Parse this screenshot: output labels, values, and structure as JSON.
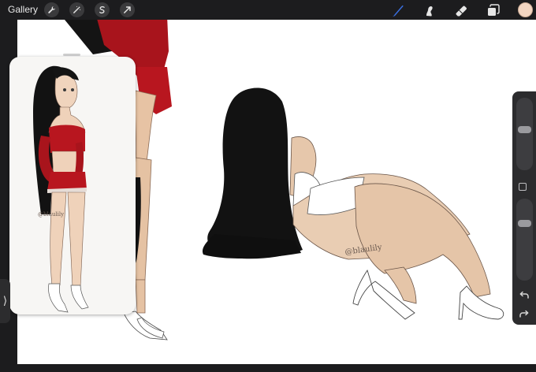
{
  "toolbar": {
    "gallery_label": "Gallery",
    "left_tools": [
      "wrench-icon",
      "magic-wand-icon",
      "selection-icon",
      "transform-arrow-icon"
    ],
    "right_tools": [
      "brush-icon",
      "smudge-icon",
      "eraser-icon",
      "layers-icon"
    ],
    "active_tool": "brush-icon",
    "accent_color": "#3a6fe0",
    "current_color": "#f3d6c2"
  },
  "sidebar": {
    "brush_size_level": 0.19,
    "opacity_level": 0.6,
    "undo_icon": "undo-icon",
    "redo_icon": "redo-icon"
  },
  "canvas": {
    "background": "#ffffff",
    "signature_text": "@blaulily"
  },
  "reference": {
    "signature_text": "@blaulily"
  },
  "left_tab_glyph": "⟩"
}
